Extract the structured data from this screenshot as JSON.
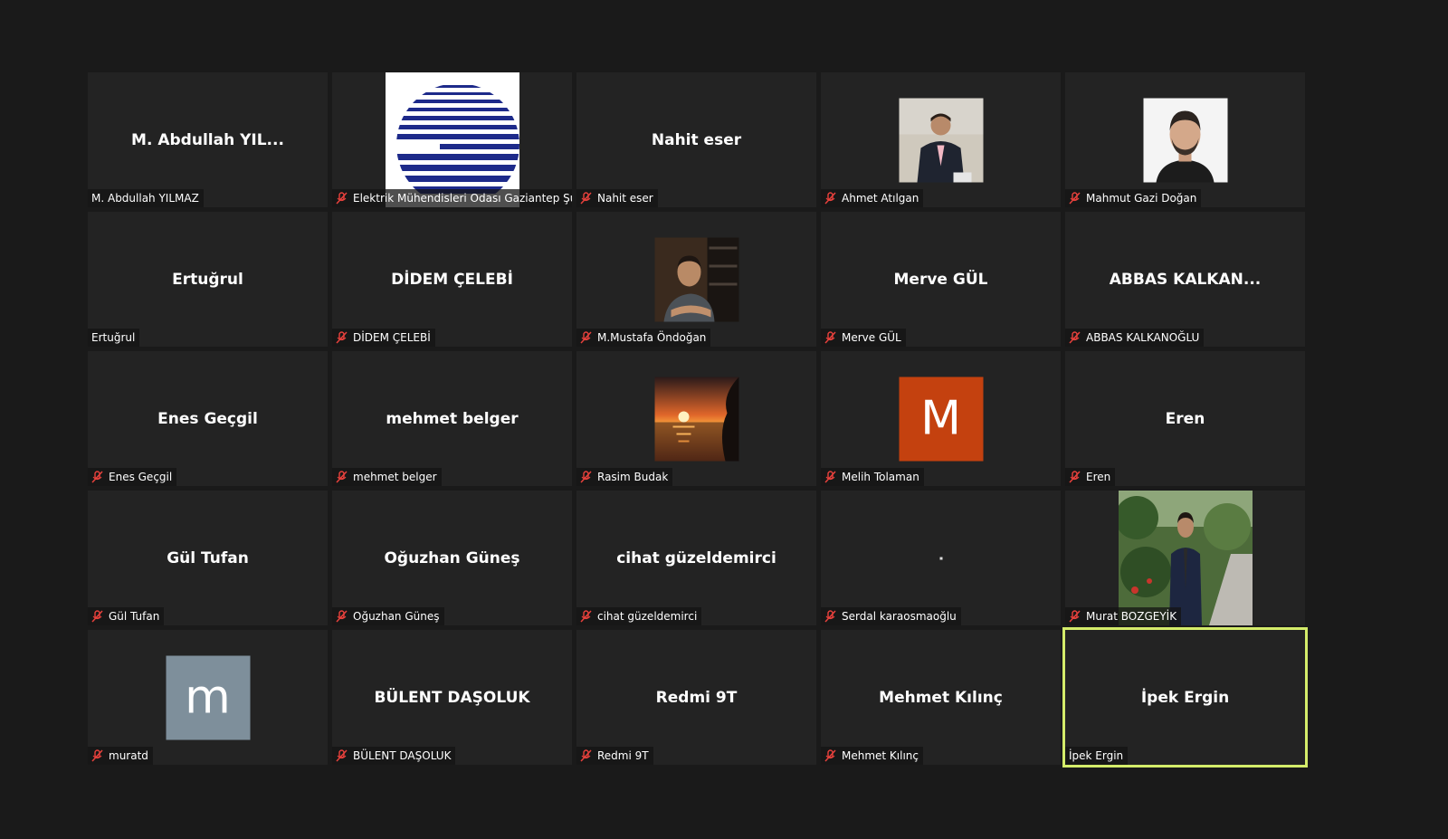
{
  "colors": {
    "background": "#1a1a1a",
    "tile": "#232323",
    "active_speaker": "#d4ec6a",
    "muted_mic": "#e8413c"
  },
  "participants": [
    {
      "display": "M. Abdullah YIL...",
      "label": "M. Abdullah YILMAZ",
      "muted": false,
      "avatar": "none"
    },
    {
      "display": "",
      "label": "Elektrik Mühendisleri Odası Gaziantep Şu...",
      "muted": true,
      "avatar": "logo-stripes-icon"
    },
    {
      "display": "Nahit eser",
      "label": "Nahit eser",
      "muted": true,
      "avatar": "none"
    },
    {
      "display": "",
      "label": "Ahmet Atılgan",
      "muted": true,
      "avatar": "profile-photo"
    },
    {
      "display": "",
      "label": "Mahmut Gazi Doğan",
      "muted": true,
      "avatar": "profile-photo"
    },
    {
      "display": "Ertuğrul",
      "label": "Ertuğrul",
      "muted": false,
      "avatar": "none"
    },
    {
      "display": "DİDEM ÇELEBİ",
      "label": "DİDEM ÇELEBİ",
      "muted": true,
      "avatar": "none"
    },
    {
      "display": "",
      "label": "M.Mustafa Öndoğan",
      "muted": true,
      "avatar": "profile-photo"
    },
    {
      "display": "Merve GÜL",
      "label": "Merve GÜL",
      "muted": true,
      "avatar": "none"
    },
    {
      "display": "ABBAS  KALKAN...",
      "label": "ABBAS KALKANOĞLU",
      "muted": true,
      "avatar": "none"
    },
    {
      "display": "Enes Geçgil",
      "label": "Enes Geçgil",
      "muted": true,
      "avatar": "none"
    },
    {
      "display": "mehmet belger",
      "label": "mehmet belger",
      "muted": true,
      "avatar": "none"
    },
    {
      "display": "",
      "label": "Rasim Budak",
      "muted": true,
      "avatar": "sunset-photo"
    },
    {
      "display": "",
      "label": "Melih Tolaman",
      "muted": true,
      "avatar": "letter",
      "letter": "M",
      "letter_bg": "#c4410f"
    },
    {
      "display": "Eren",
      "label": "Eren",
      "muted": true,
      "avatar": "none"
    },
    {
      "display": "Gül Tufan",
      "label": "Gül Tufan",
      "muted": true,
      "avatar": "none"
    },
    {
      "display": "Oğuzhan Güneş",
      "label": "Oğuzhan Güneş",
      "muted": true,
      "avatar": "none"
    },
    {
      "display": "cihat güzeldemirci",
      "label": "cihat güzeldemirci",
      "muted": true,
      "avatar": "none"
    },
    {
      "display": "",
      "label": "Serdal karaosmaoğlu",
      "muted": true,
      "avatar": "dot"
    },
    {
      "display": "",
      "label": "Murat BOZGEYİK",
      "muted": true,
      "avatar": "garden-photo"
    },
    {
      "display": "",
      "label": "muratd",
      "muted": true,
      "avatar": "letter",
      "letter": "m",
      "letter_bg": "#7e8f9b"
    },
    {
      "display": "BÜLENT DAŞOLUK",
      "label": "BÜLENT DAŞOLUK",
      "muted": true,
      "avatar": "none"
    },
    {
      "display": "Redmi 9T",
      "label": "Redmi 9T",
      "muted": true,
      "avatar": "none"
    },
    {
      "display": "Mehmet Kılınç",
      "label": "Mehmet Kılınç",
      "muted": true,
      "avatar": "none"
    },
    {
      "display": "İpek Ergin",
      "label": "İpek Ergin",
      "muted": false,
      "avatar": "none",
      "active": true
    }
  ]
}
